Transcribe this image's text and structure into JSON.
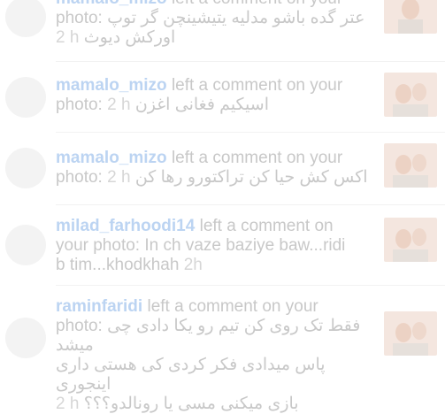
{
  "notifications": [
    {
      "username": "mamalo_mizo",
      "action": "left a comment on your",
      "prefix": "photo:",
      "comment": "عتر گده باشو مدلیه یتیشینچن گر توپ",
      "comment2": "اورکش دیوث",
      "time": "2 h"
    },
    {
      "username": "mamalo_mizo",
      "action": "left a comment on your",
      "prefix": "photo:",
      "comment": "اسیکیم فغانی اغزن",
      "time": "2 h"
    },
    {
      "username": "mamalo_mizo",
      "action": "left a comment on your",
      "prefix": "photo:",
      "comment": "اکس کش حیا کن تراکتورو رها کن",
      "time": "2 h"
    },
    {
      "username": "milad_farhoodi14",
      "action": "left a comment on",
      "line2": "your photo: In ch vaze baziye baw...ridi",
      "line3": "b tim...khodkhah",
      "time": "2h"
    },
    {
      "username": "raminfaridi",
      "action": "left a comment on your",
      "prefix": "photo:",
      "comment": "فقط تک روی کن تیم رو یکا دادی چی میشد",
      "comment2": "پاس میدادی فکر کردی کی هستی داری اینجوری",
      "comment3": "بازی میکنی مسی یا رونالدو؟؟؟",
      "time": "2 h"
    }
  ]
}
